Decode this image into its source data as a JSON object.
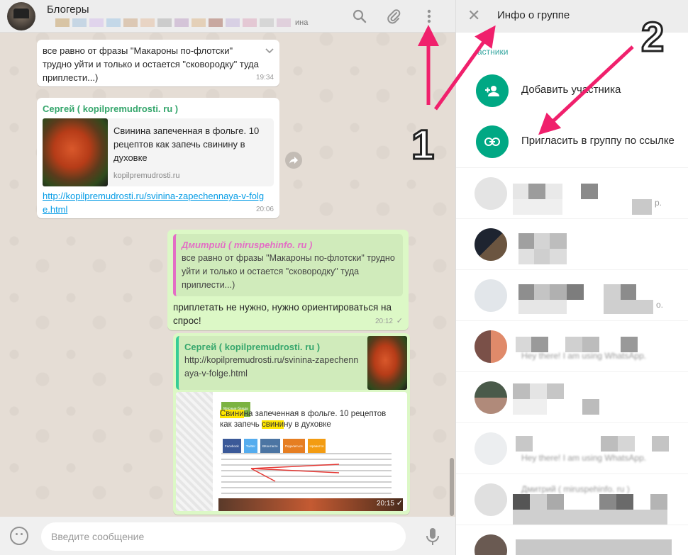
{
  "chat": {
    "title": "Блогеры",
    "subtitle_tail": "ина",
    "input_placeholder": "Введите сообщение",
    "messages": {
      "m1": {
        "text": "все равно от фразы \"Макароны по-флотски\" трудно уйти и только и остается \"сковородку\" туда приплести...)",
        "time": "19:34"
      },
      "m2": {
        "author": "Сергей ( kopilpremudrosti. ru )",
        "preview_title": "Свинина запеченная в фольге. 10 рецептов как запечь свинину в духовке",
        "preview_domain": "kopilpremudrosti.ru",
        "link": "http://kopilpremudrosti.ru/svinina-zapechennaya-v-folge.html",
        "time": "20:06"
      },
      "m3": {
        "quote_author": "Дмитрий ( miruspehinfo. ru )",
        "quote_text": "все равно от фразы \"Макароны по-флотски\" трудно уйти и только и остается \"сковородку\" туда приплести...)",
        "text": "приплетать не нужно, нужно ориентироваться на спрос!",
        "time": "20:12"
      },
      "m4": {
        "quote_author": "Сергей ( kopilpremudrosti. ru )",
        "quote_text": "http://kopilpremudrosti.ru/svinina-zapechennaya-v-folge.html",
        "shot_title_a": "Свини",
        "shot_title_b": "на запеченная в фольге. 10 рецептов как запечь ",
        "shot_title_c": "свини",
        "shot_title_d": "ну в духовке",
        "shot_tag": "Мясные блюда",
        "shot_btn1": "Facebook",
        "shot_btn2": "Twitter",
        "shot_btn3": "ВКонтакте",
        "shot_btn4": "Поделиться",
        "shot_btn5": "Нравится",
        "time": "20:15"
      }
    }
  },
  "info": {
    "title": "Инфо о группе",
    "participants_label": "астники",
    "add_participant": "Добавить участника",
    "invite_link": "Пригласить в группу по ссылке",
    "members": [
      {
        "status": "р."
      },
      {
        "status": ""
      },
      {
        "status": "о."
      },
      {
        "status": "Hey there! I am using WhatsApp."
      },
      {
        "status": ""
      },
      {
        "status": "Hey there! I am using WhatsApp."
      },
      {
        "status": "Дмитрий ( miruspehinfo. ru )"
      },
      {
        "status": ""
      }
    ]
  },
  "annotations": {
    "label1": "1",
    "label2": "2",
    "arrow_color": "#f0206c"
  },
  "colors": {
    "accent": "#00a884",
    "outgoing": "#dcf8c6",
    "chat_bg": "#e5ddd5"
  }
}
